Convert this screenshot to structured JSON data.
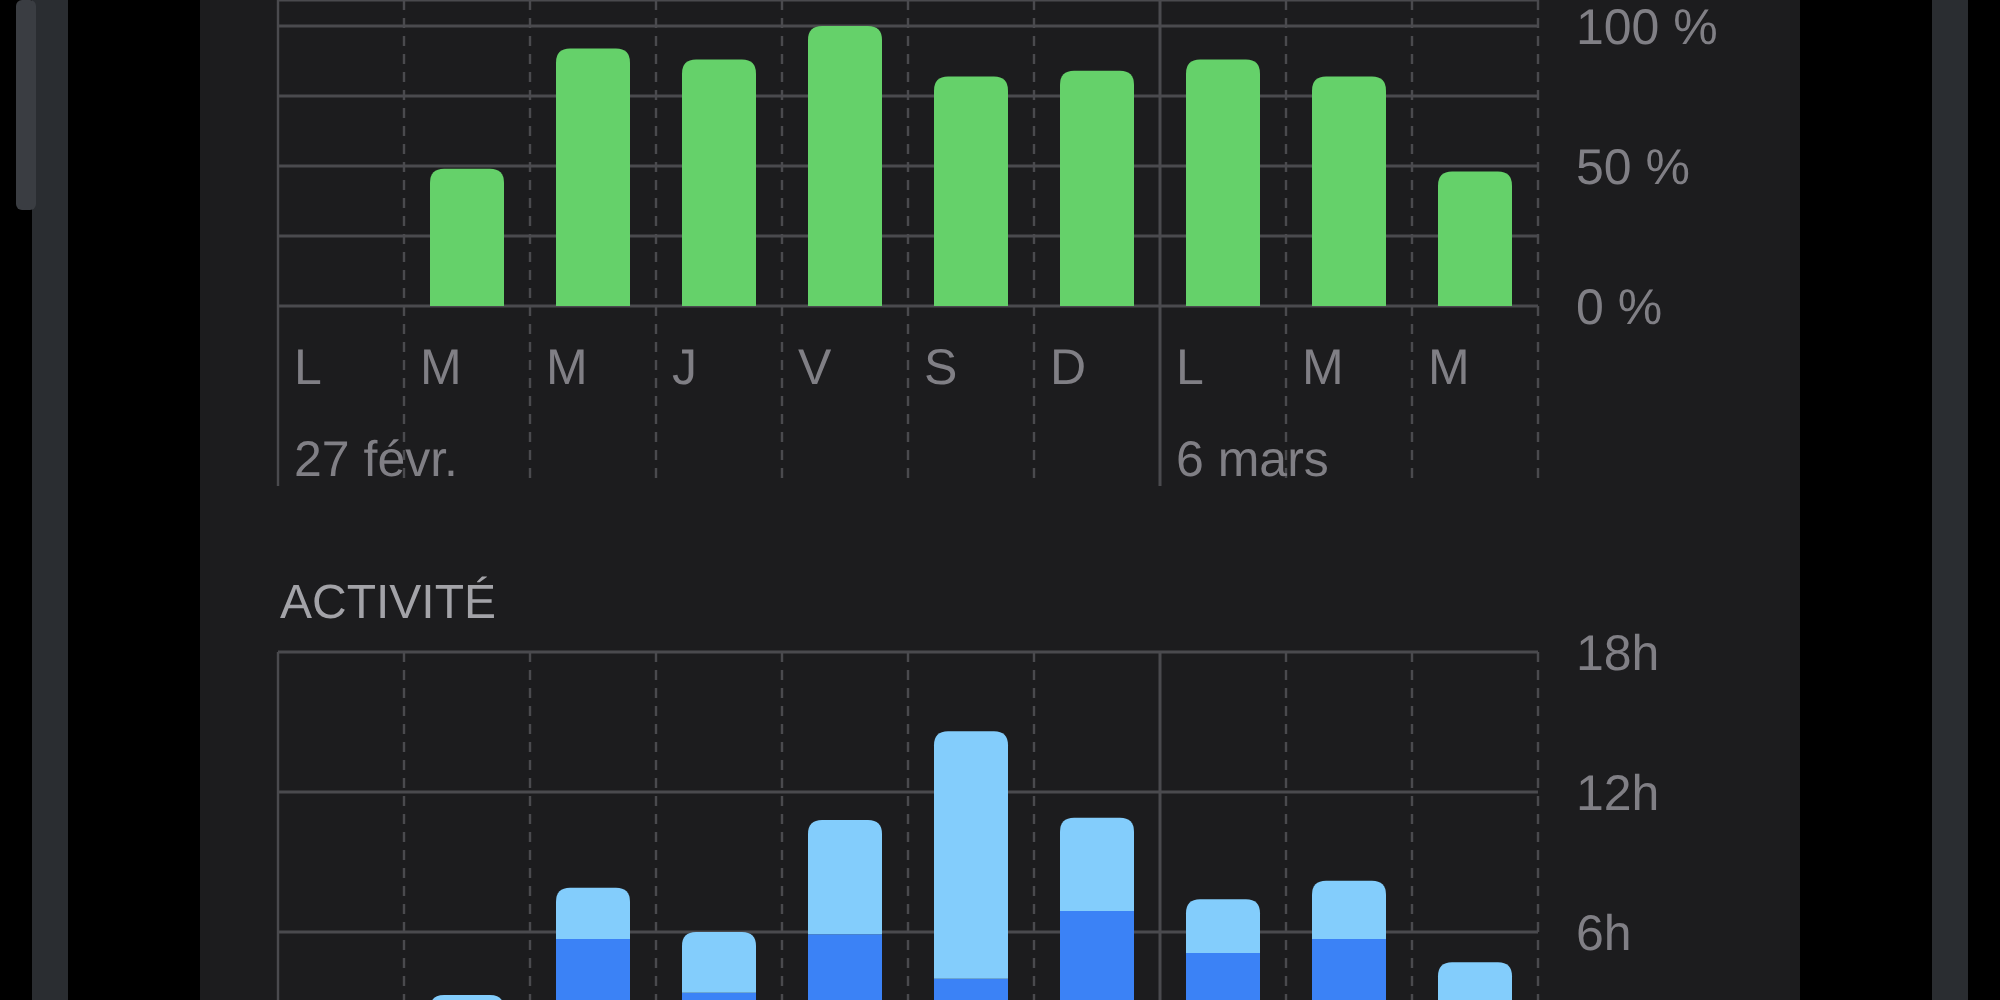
{
  "battery_level_chart": {
    "dates": [
      "27 févr.",
      "6 mars"
    ],
    "chart_data": {
      "type": "bar",
      "categories": [
        "L",
        "M",
        "M",
        "J",
        "V",
        "S",
        "D",
        "L",
        "M",
        "M"
      ],
      "series": [
        {
          "color": "#65d16a",
          "values": [
            0,
            49,
            92,
            88,
            100,
            82,
            84,
            88,
            82,
            48
          ]
        }
      ],
      "ylim": [
        0,
        100
      ],
      "yticks": [
        {
          "value": 0,
          "label": "0 %"
        },
        {
          "value": 50,
          "label": "50 %"
        },
        {
          "value": 100,
          "label": "100 %"
        }
      ]
    }
  },
  "activity": {
    "title": "ACTIVITÉ",
    "chart_data": {
      "type": "bar",
      "stacked": true,
      "series": [
        {
          "color": "#3b82f6",
          "values": [
            0,
            null,
            5.7,
            3.4,
            5.9,
            4.0,
            6.9,
            5.1,
            5.7,
            null
          ]
        },
        {
          "color": "#83cdfc",
          "values": [
            0,
            3.3,
            2.2,
            2.6,
            4.9,
            10.6,
            4.0,
            2.3,
            2.5,
            4.7
          ]
        }
      ],
      "ylim": [
        0,
        18
      ],
      "yticks": [
        {
          "value": 6,
          "label": "6h"
        },
        {
          "value": 12,
          "label": "12h"
        },
        {
          "value": 18,
          "label": "18h"
        }
      ]
    }
  }
}
